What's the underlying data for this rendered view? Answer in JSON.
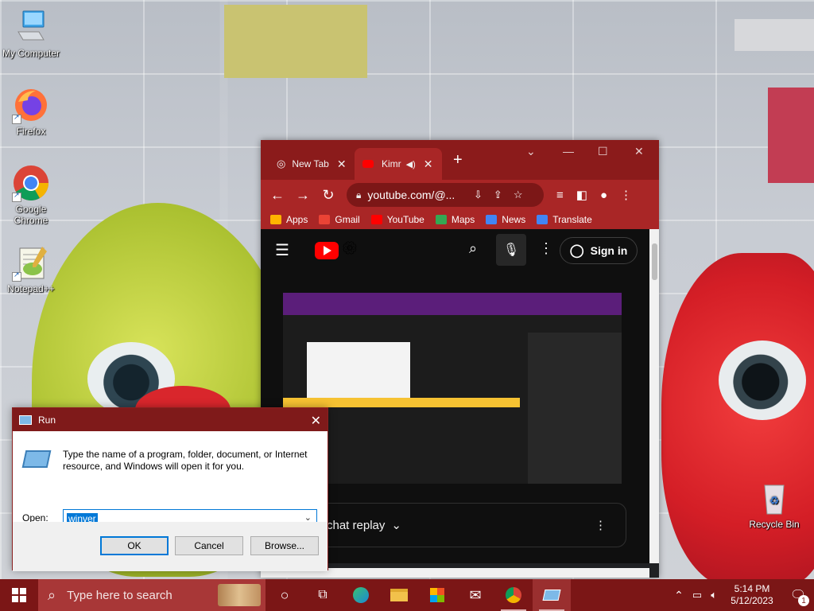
{
  "desktop": {
    "icons": [
      {
        "label": "My Computer"
      },
      {
        "label": "Firefox"
      },
      {
        "label": "Google Chrome"
      },
      {
        "label": "Notepad++"
      },
      {
        "label": "Recycle Bin"
      }
    ]
  },
  "browser": {
    "tabs": [
      {
        "label": "New Tab"
      },
      {
        "label": "Kimr"
      }
    ],
    "new_tab_symbol": "+",
    "address": "youtube.com/@...",
    "bookmarks": [
      {
        "label": "Apps",
        "color": "#ffb400"
      },
      {
        "label": "Gmail",
        "color": "#ea4335"
      },
      {
        "label": "YouTube",
        "color": "#ff0000"
      },
      {
        "label": "Maps",
        "color": "#34a853"
      },
      {
        "label": "News",
        "color": "#4285f4"
      },
      {
        "label": "Translate",
        "color": "#4285f4"
      }
    ],
    "youtube": {
      "sign_in_label": "Sign in",
      "chat_replay_label": "chat replay"
    }
  },
  "run_dialog": {
    "title": "Run",
    "message": "Type the name of a program, folder, document, or Internet resource, and Windows will open it for you.",
    "open_label": "Open:",
    "open_value": "winver",
    "ok_label": "OK",
    "cancel_label": "Cancel",
    "browse_label": "Browse..."
  },
  "taskbar": {
    "search_placeholder": "Type here to search",
    "time": "5:14 PM",
    "date": "5/12/2023",
    "notification_count": "1"
  },
  "colors": {
    "accent_dark": "#7b1616",
    "accent": "#a92626",
    "selection": "#0078d7"
  }
}
